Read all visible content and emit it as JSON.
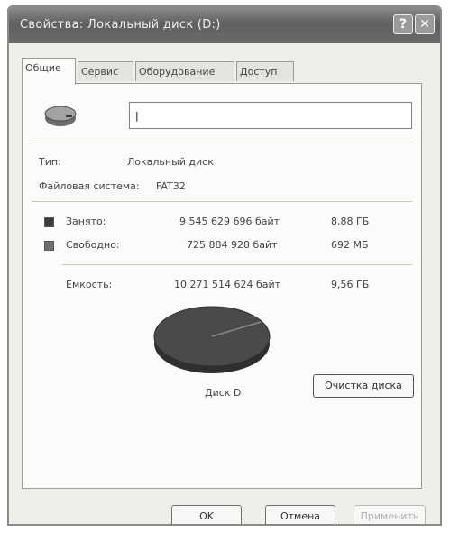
{
  "window": {
    "title": "Свойства: Локальный диск (D:)",
    "help_glyph": "?",
    "close_glyph": "✕"
  },
  "tabs": [
    {
      "label": "Общие",
      "active": true
    },
    {
      "label": "Сервис",
      "active": false
    },
    {
      "label": "Оборудование",
      "active": false
    },
    {
      "label": "Доступ",
      "active": false
    }
  ],
  "general": {
    "name_value": "|",
    "type_label": "Тип:",
    "type_value": "Локальный диск",
    "fs_label": "Файловая система:",
    "fs_value": "FAT32",
    "used": {
      "label": "Занято:",
      "bytes": "9 545 629 696 байт",
      "size": "8,88 ГБ",
      "color": "#3c3c3c"
    },
    "free": {
      "label": "Свободно:",
      "bytes": "725 884 928 байт",
      "size": "692 МБ",
      "color": "#6e6e6e"
    },
    "capacity": {
      "label": "Емкость:",
      "bytes": "10 271 514 624 байт",
      "size": "9,56 ГБ"
    },
    "disk_label": "Диск D",
    "cleanup_label": "Очистка диска"
  },
  "buttons": {
    "ok": "OK",
    "cancel": "Отмена",
    "apply": "Применить"
  }
}
